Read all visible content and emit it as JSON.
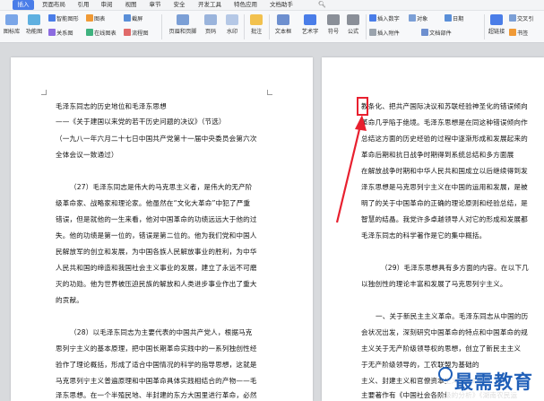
{
  "tabs": [
    {
      "label": "插入",
      "active": true
    },
    {
      "label": "页面布局",
      "active": false
    },
    {
      "label": "引用",
      "active": false
    },
    {
      "label": "审阅",
      "active": false
    },
    {
      "label": "视图",
      "active": false
    },
    {
      "label": "章节",
      "active": false
    },
    {
      "label": "安全",
      "active": false
    },
    {
      "label": "开发工具",
      "active": false
    },
    {
      "label": "特色应用",
      "active": false
    },
    {
      "label": "文档助手",
      "active": false
    }
  ],
  "search_icon": "search-icon",
  "toolbar": {
    "smart_graph": "智能图形",
    "chart": "图表",
    "screenshot": "截屏",
    "relation_graph": "关系图",
    "online_chart": "在线图表",
    "flowchart": "流程图",
    "gallery": "图标库",
    "func_graph": "功能图",
    "header_footer": "页眉和页脚",
    "page_number": "页码",
    "watermark": "水印",
    "comment": "批注",
    "textbox": "文本框",
    "art_text": "艺术字",
    "symbol": "符号",
    "formula": "公式",
    "insert_number": "插入数字",
    "object": "对象",
    "date": "日期",
    "attachment": "插入附件",
    "doc_parts": "文档部件",
    "hyperlink": "超链接",
    "cross_ref": "交叉引",
    "bookmark": "书签"
  },
  "accent_color": "#4a7de8",
  "highlight_color": "#e8202f",
  "page1": {
    "lines": [
      "毛泽东同志的历史地位和毛泽东思想",
      "——《关于建国以来党的若干历史问题的决议》（节选）",
      "（一九八一年六月二十七日中国共产党第十一届中央委员会第六次",
      "全体会议一致通过）",
      "（27）毛泽东同志是伟大的马克思主义者，是伟大的无产阶",
      "级革命家、战略家和理论家。他虽然在“文化大革命”中犯了严重",
      "错误，但是就他的一生来看，他对中国革命的功绩远远大于他的过",
      "失。他的功绩是第一位的，错误是第二位的。他为我们党和中国人",
      "民解放军的创立和发展，为中国各族人民解放事业的胜利，为中华",
      "人民共和国的缔造和我国社会主义事业的发展，建立了永远不可磨",
      "灭的功勋。他为世界被压迫民族的解放和人类进步事业作出了重大",
      "的贡献。",
      "（28）以毛泽东同志为主要代表的中国共产党人，根据马克",
      "思列宁主义的基本原理，把中国长期革命实践中的一系列独创性经",
      "验作了理论概括，形成了适合中国情况的科学的指导思想，这就是",
      "马克思列宁主义普遍原理和中国革命具体实践相结合的产物——毛",
      "泽东思想。在一个半殖民地、半封建的东方大国里进行革命，必然"
    ]
  },
  "page2": {
    "lines": [
      "教条化、把共产国际决议和苏联经验神圣化的错误倾向",
      "革命几乎陷于绝境。毛泽东思想是在同这种错误倾向作",
      "总结这方面的历史经验的过程中逐渐形成和发展起来的",
      "革命后期和抗日战争时期得到系统总结和多方面展",
      "在解放战争时期和中华人民共和国成立以后继续得到发",
      "泽东思想是马克思列宁主义在中国的运用和发展，是被",
      "明了的关于中国革命的正确的理论原则和经验总结，是",
      "智慧的结晶。我党许多卓越领导人对它的形成和发展都",
      "毛泽东同志的科学著作是它的集中概括。",
      "（29）毛泽东思想具有多方面的内容。在以下几",
      "以独创性的理论丰富和发展了马克思列宁主义。",
      "一、关于新民主主义革命。毛泽东同志从中国的历",
      "会状况出发，深刻研究中国革命的特点和中国革命的规",
      "主义关于无产阶级领导权的思想，创立了新民主主义",
      "于无产阶级领导的，工农联盟为基础的",
      "主义、封建主义和官僚资本主义的革命。",
      "主要著作有《中国社会各阶级的分析》《湖南农民运"
    ]
  },
  "watermark": {
    "text": "最需教育"
  }
}
